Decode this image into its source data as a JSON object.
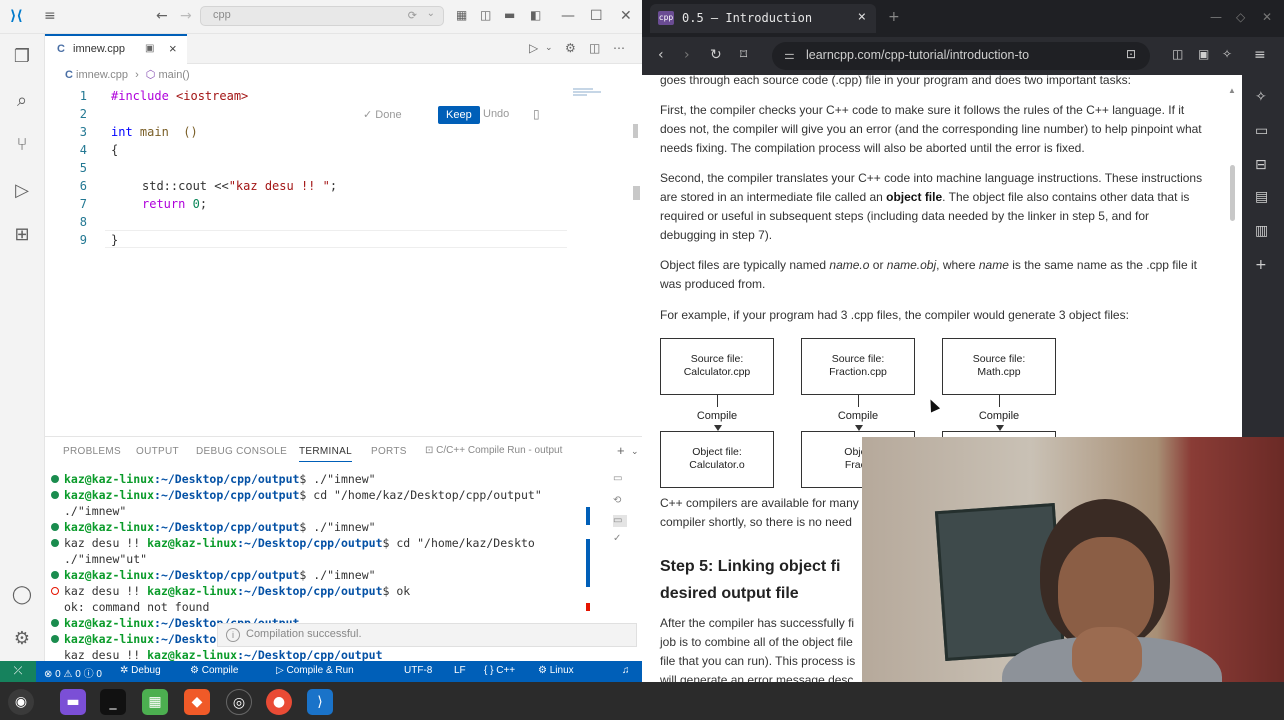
{
  "vscode": {
    "search_text": "cpp",
    "tab_file": "imnew.cpp",
    "breadcrumb_file": "imnew.cpp",
    "breadcrumb_symbol": "main()",
    "inline_chat": {
      "done": "Done",
      "keep": "Keep",
      "undo": "Undo"
    },
    "code_lines": [
      {
        "n": "1"
      },
      {
        "n": "2"
      },
      {
        "n": "3"
      },
      {
        "n": "4"
      },
      {
        "n": "5"
      },
      {
        "n": "6"
      },
      {
        "n": "7"
      },
      {
        "n": "8"
      },
      {
        "n": "9"
      }
    ],
    "code": {
      "l1_pre": "#include ",
      "l1_inc": "<iostream>",
      "l3_type": "int",
      "l3_rest": " main  ()",
      "l4": "{",
      "l6_a": "std::cout <<",
      "l6_str": "\"kaz desu !! \"",
      "l6_end": ";",
      "l7_kw": "return",
      "l7_num": "0",
      "l7_end": ";",
      "l9": "}"
    },
    "panel_tabs": [
      "PROBLEMS",
      "OUTPUT",
      "DEBUG CONSOLE",
      "TERMINAL",
      "PORTS"
    ],
    "panel_task": "C/C++ Compile Run - output",
    "terminal": {
      "user": "kaz@kaz-linux",
      "path": ":~/Desktop/cpp/output",
      "lines": [
        {
          "kind": "ok",
          "pre": "",
          "cmd": "$ ./\"imnew\""
        },
        {
          "kind": "ok",
          "pre": "",
          "cmd": "$ cd \"/home/kaz/Desktop/cpp/output\""
        },
        {
          "kind": "cont",
          "text": "./\"imnew\""
        },
        {
          "kind": "ok",
          "pre": "",
          "cmd": "$ ./\"imnew\""
        },
        {
          "kind": "ok",
          "pre": "kaz desu !! ",
          "cmd": "$ cd \"/home/kaz/Deskto"
        },
        {
          "kind": "cont",
          "text": "./\"imnew\"ut\""
        },
        {
          "kind": "ok",
          "pre": "",
          "cmd": "$ ./\"imnew\""
        },
        {
          "kind": "err",
          "pre": "kaz desu !! ",
          "cmd": "$ ok"
        },
        {
          "kind": "cont",
          "text": "ok: command not found"
        },
        {
          "kind": "ok",
          "pre": "",
          "cmd": ""
        },
        {
          "kind": "ok",
          "pre": "",
          "cmd": ""
        },
        {
          "kind": "cont2",
          "pre": "kaz desu !! ",
          "cmd": ""
        }
      ]
    },
    "toast": "Compilation successful.",
    "status": {
      "errors": "0",
      "warnings": "0",
      "info": "0",
      "debug": "Debug",
      "compile": "Compile",
      "compile_run": "Compile & Run",
      "encoding": "UTF-8",
      "eol": "LF",
      "lang": "C++",
      "os": "Linux"
    }
  },
  "browser": {
    "tab_title": "0.5 — Introduction",
    "favicon": "cpp",
    "url": "learncpp.com/cpp-tutorial/introduction-to",
    "paragraphs": {
      "p0": "goes through each source code (.cpp) file in your program and does two important tasks:",
      "p1": "First, the compiler checks your C++ code to make sure it follows the rules of the C++ language. If it does not, the compiler will give you an error (and the corresponding line number) to help pinpoint what needs fixing. The compilation process will also be aborted until the error is fixed.",
      "p2_a": "Second, the compiler translates your C++ code into machine language instructions. These instructions are stored in an intermediate file called an ",
      "p2_b": "object file",
      "p2_c": ". The object file also contains other data that is required or useful in subsequent steps (including data needed by the linker in step 5, and for debugging in step 7).",
      "p3_a": "Object files are typically named ",
      "p3_b": "name.o",
      "p3_c": " or ",
      "p3_d": "name.obj",
      "p3_e": ", where ",
      "p3_f": "name",
      "p3_g": " is the same name as the .cpp file it was produced from.",
      "p4": "For example, if your program had 3 .cpp files, the compiler would generate 3 object files:",
      "p5_a": "C++ compilers are available for many",
      "p5_b": "compiler shortly, so there is no need",
      "p6_a": "After the compiler has successfully fi",
      "p6_b": "job is to combine all of the object file",
      "p6_c": "file that you can run). This process is",
      "p6_d": "will generate an error message desc"
    },
    "diagram": {
      "sources": [
        {
          "l1": "Source file:",
          "l2": "Calculator.cpp"
        },
        {
          "l1": "Source file:",
          "l2": "Fraction.cpp"
        },
        {
          "l1": "Source file:",
          "l2": "Math.cpp"
        }
      ],
      "compile_label": "Compile",
      "objects": [
        {
          "l1": "Object file:",
          "l2": "Calculator.o"
        },
        {
          "l1": "Objec",
          "l2": "Fracti"
        },
        {
          "l1": "",
          "l2": ""
        }
      ]
    },
    "heading_a": "Step 5: Linking object fi",
    "heading_b": "desired output file"
  },
  "colors": {
    "vscode_accent": "#005fb8",
    "terminal_user": "#0a9b2a",
    "terminal_path": "#0451a5",
    "browser_chrome": "#2b2c31"
  }
}
